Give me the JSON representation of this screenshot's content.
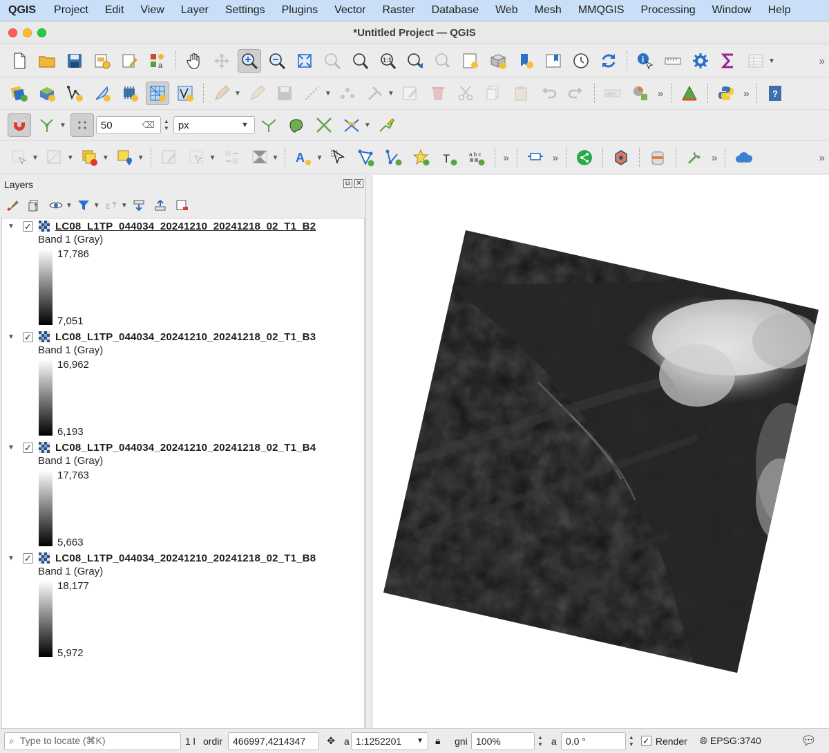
{
  "menubar": {
    "app": "QGIS",
    "items": [
      "Project",
      "Edit",
      "View",
      "Layer",
      "Settings",
      "Plugins",
      "Vector",
      "Raster",
      "Database",
      "Web",
      "Mesh",
      "MMQGIS",
      "Processing",
      "Window",
      "Help"
    ]
  },
  "window": {
    "title": "*Untitled Project — QGIS"
  },
  "snapping": {
    "tolerance": "50",
    "units": "px"
  },
  "layers_panel": {
    "title": "Layers",
    "float_glyph": "⧉",
    "close_glyph": "✕",
    "layers": [
      {
        "name": "LC08_L1TP_044034_20241210_20241218_02_T1_B2",
        "band": "Band 1 (Gray)",
        "max": "17,786",
        "min": "7,051",
        "checked": "✓",
        "selected": true
      },
      {
        "name": "LC08_L1TP_044034_20241210_20241218_02_T1_B3",
        "band": "Band 1 (Gray)",
        "max": "16,962",
        "min": "6,193",
        "checked": "✓"
      },
      {
        "name": "LC08_L1TP_044034_20241210_20241218_02_T1_B4",
        "band": "Band 1 (Gray)",
        "max": "17,763",
        "min": "5,663",
        "checked": "✓"
      },
      {
        "name": "LC08_L1TP_044034_20241210_20241218_02_T1_B8",
        "band": "Band 1 (Gray)",
        "max": "18,177",
        "min": "5,972",
        "checked": "✓"
      }
    ]
  },
  "statusbar": {
    "locator_placeholder": "Type to locate (⌘K)",
    "legend_status": "1 l",
    "coordinate_label": "ordir",
    "coordinate": "466997,4214347",
    "scale_label": "a",
    "scale": "1:1252201",
    "magnifier_label": "gni",
    "magnifier": "100%",
    "rotation_label": "a",
    "rotation": "0.0 °",
    "render_label": "Render",
    "render_checked": "✓",
    "crs": "EPSG:3740"
  },
  "colors": {
    "menubar_bg": "#c9dff7",
    "accent_blue": "#2a6fc9",
    "raster_dark": "#141414"
  }
}
